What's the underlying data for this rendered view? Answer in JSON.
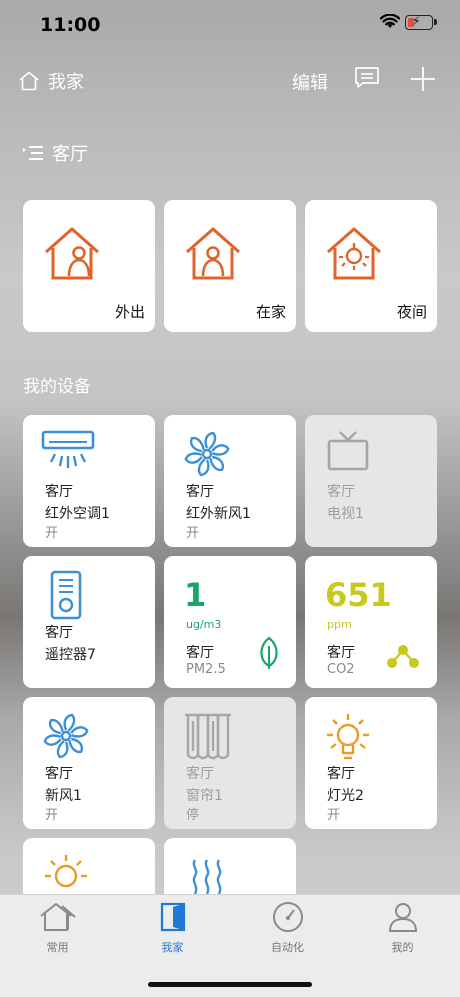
{
  "status": {
    "time": "11:00"
  },
  "nav": {
    "home_label": "我家",
    "edit_label": "编辑"
  },
  "room": {
    "label": "客厅"
  },
  "scenes": [
    {
      "label": "外出",
      "icon": "house-person-icon"
    },
    {
      "label": "在家",
      "icon": "house-person-icon"
    },
    {
      "label": "夜间",
      "icon": "house-bulb-icon"
    }
  ],
  "devices_title": "我的设备",
  "devices": [
    {
      "room": "客厅",
      "name": "红外空调1",
      "state": "开",
      "icon": "air-conditioner-icon",
      "active": true
    },
    {
      "room": "客厅",
      "name": "红外新风1",
      "state": "开",
      "icon": "fan-icon",
      "active": true
    },
    {
      "room": "客厅",
      "name": "电视1",
      "state": "",
      "icon": "tv-icon",
      "active": false
    },
    {
      "room": "客厅",
      "name": "遥控器7",
      "state": "",
      "icon": "remote-control-icon",
      "active": true
    },
    {
      "room": "客厅",
      "name": "新风1",
      "state": "开",
      "icon": "fan-icon",
      "active": true
    },
    {
      "room": "客厅",
      "name": "窗帘1",
      "state": "停",
      "icon": "curtain-icon",
      "active": false
    },
    {
      "room": "客厅",
      "name": "灯光2",
      "state": "开",
      "icon": "light-bulb-icon",
      "active": true
    }
  ],
  "sensors": [
    {
      "value": "1",
      "unit": "ug/m3",
      "room": "客厅",
      "name": "PM2.5",
      "color": "#1aa56a",
      "icon": "leaf-icon"
    },
    {
      "value": "651",
      "unit": "ppm",
      "room": "客厅",
      "name": "CO2",
      "color": "#c8c81e",
      "icon": "molecule-icon"
    }
  ],
  "tabs": [
    {
      "label": "常用",
      "icon": "house-outline-icon",
      "active": false
    },
    {
      "label": "我家",
      "icon": "door-icon",
      "active": true
    },
    {
      "label": "自动化",
      "icon": "gauge-icon",
      "active": false
    },
    {
      "label": "我的",
      "icon": "user-icon",
      "active": false
    }
  ],
  "colors": {
    "accent_blue": "#3d8fd6",
    "accent_orange": "#e0632a",
    "bulb_orange": "#ee9a22",
    "inactive_gray": "#a6a6a6",
    "tab_active": "#1f7ad6"
  }
}
